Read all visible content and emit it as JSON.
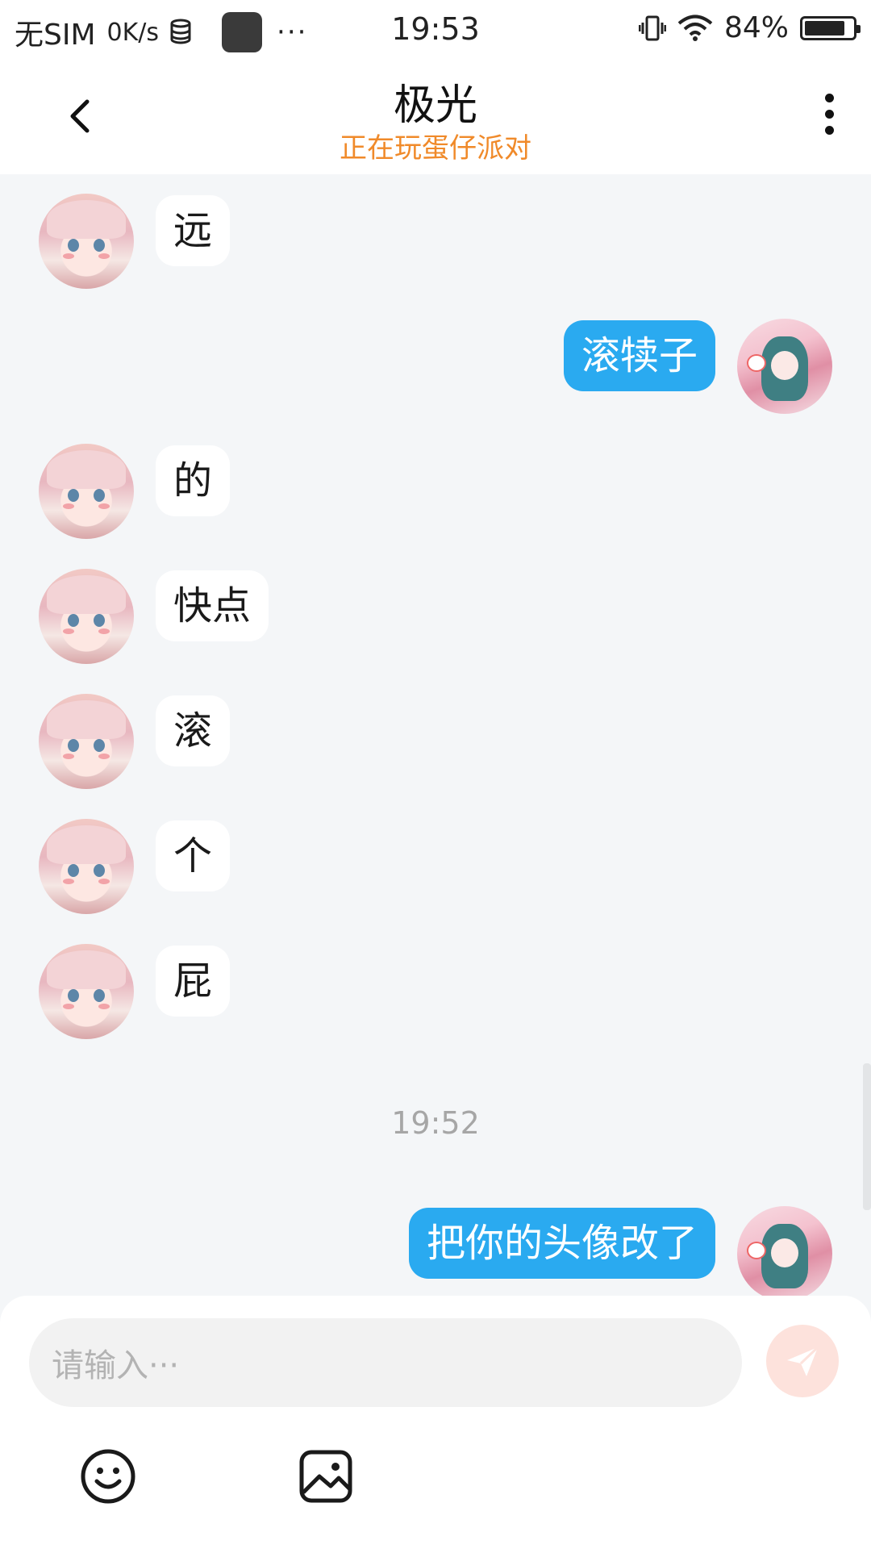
{
  "status_bar": {
    "carrier": "无SIM",
    "speed": "0K/s",
    "more": "···",
    "time": "19:53",
    "battery_text": "84%",
    "battery_level": 0.84
  },
  "header": {
    "title": "极光",
    "subtitle": "正在玩蛋仔派对"
  },
  "messages": [
    {
      "side": "in",
      "text": "远"
    },
    {
      "side": "out",
      "text": "滚犊子"
    },
    {
      "side": "in",
      "text": "的"
    },
    {
      "side": "in",
      "text": "快点"
    },
    {
      "side": "in",
      "text": "滚"
    },
    {
      "side": "in",
      "text": "个"
    },
    {
      "side": "in",
      "text": "屁"
    },
    {
      "side": "time",
      "text": "19:52"
    },
    {
      "side": "out",
      "text": "把你的头像改了"
    }
  ],
  "input": {
    "placeholder": "请输入···"
  },
  "icons": {
    "back": "chevron-left-icon",
    "menu": "more-vertical-icon",
    "send": "send-icon",
    "emoji": "emoji-icon",
    "image": "image-icon"
  },
  "colors": {
    "accent_blue": "#2aaaf0",
    "subtitle_orange": "#f08a2a",
    "send_disabled": "#fde2dc"
  }
}
